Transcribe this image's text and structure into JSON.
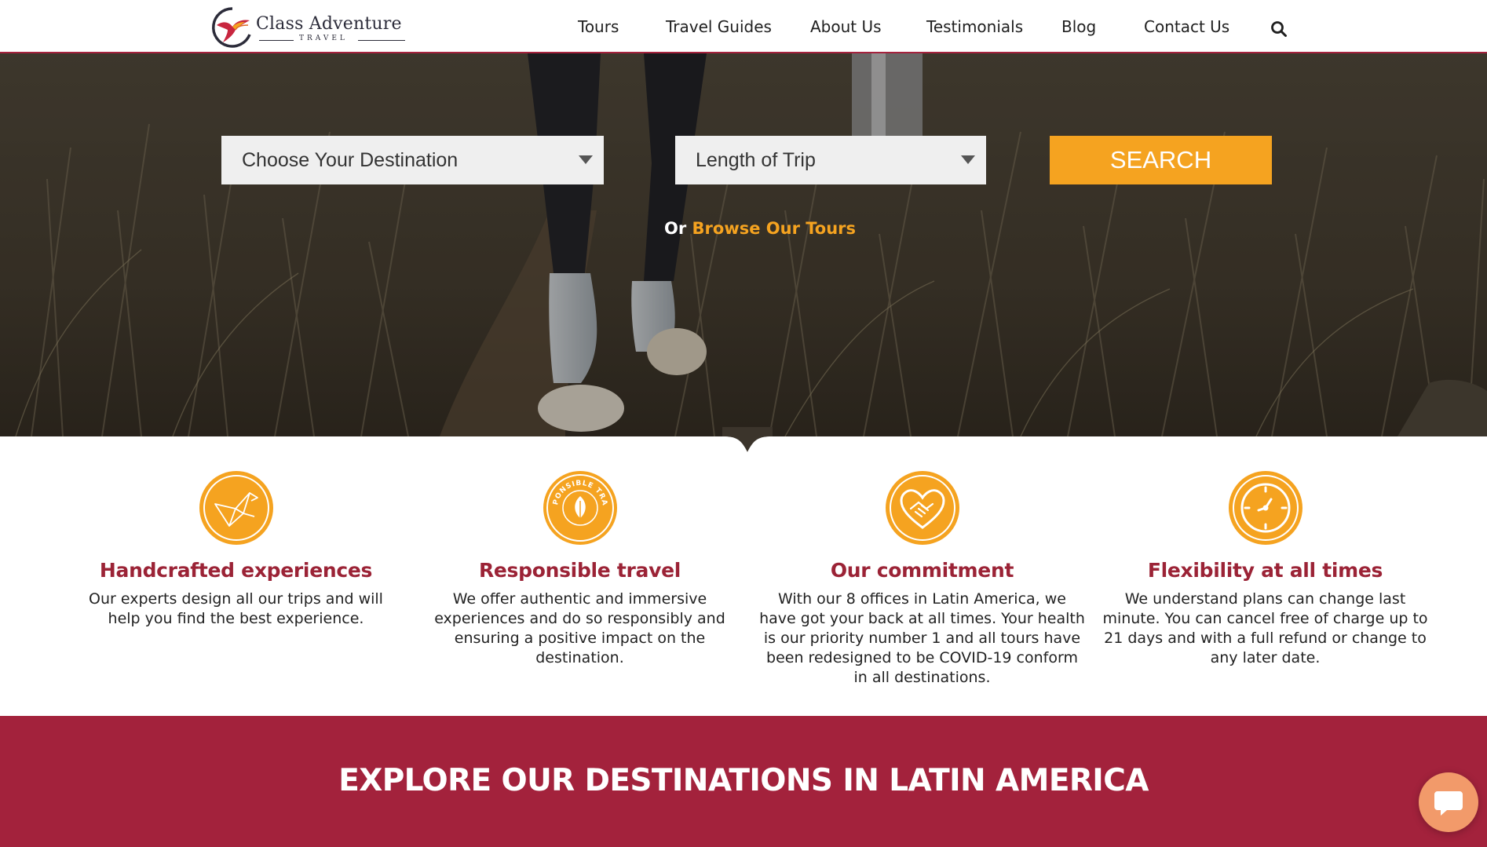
{
  "brand": {
    "name": "Class Adventure",
    "subtitle": "TRAVEL"
  },
  "nav": {
    "items": [
      {
        "label": "Tours"
      },
      {
        "label": "Travel Guides"
      },
      {
        "label": "About Us"
      },
      {
        "label": "Testimonials"
      },
      {
        "label": "Blog"
      },
      {
        "label": "Contact Us"
      }
    ],
    "search_icon": "search-icon"
  },
  "hero": {
    "destination_select": "Choose Your Destination",
    "length_select": "Length of Trip",
    "search_button": "SEARCH",
    "browse_prefix": "Or",
    "browse_link": "Browse Our Tours"
  },
  "features": [
    {
      "icon": "origami-bird-icon",
      "title": "Handcrafted experiences",
      "body": "Our experts design all our trips and will help you find the best experience."
    },
    {
      "icon": "responsible-travel-leaf-icon",
      "badge_text": "RESPONSIBLE TRAVEL",
      "title": "Responsible travel",
      "body": "We offer authentic and immersive experiences and do so responsibly and ensuring a positive impact on the destination."
    },
    {
      "icon": "heart-handshake-icon",
      "title": "Our commitment",
      "body": "With our 8 offices in Latin America, we have got your back at all times. Your health is our priority number 1 and all tours have been redesigned to be COVID-19 conform in all destinations."
    },
    {
      "icon": "clock-icon",
      "title": "Flexibility at all times",
      "body": "We understand plans can change last minute. You can cancel free of charge up to 21 days and with a full refund or change to any later date."
    }
  ],
  "destinations": {
    "heading": "EXPLORE OUR DESTINATIONS IN LATIN AMERICA"
  },
  "chat": {
    "icon": "chat-bubble-icon"
  },
  "colors": {
    "accent": "#f5a320",
    "brand_red": "#a3223c",
    "title_red": "#9b2336"
  }
}
